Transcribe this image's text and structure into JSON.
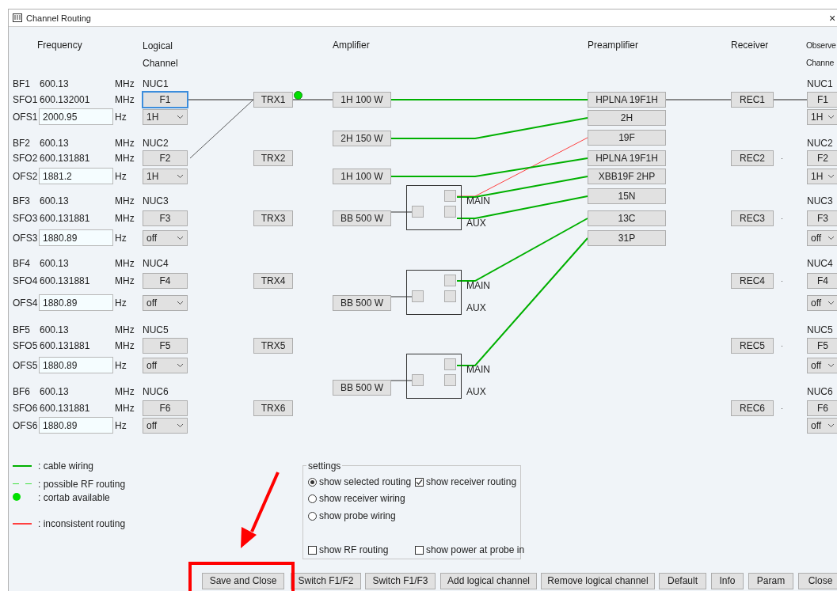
{
  "window": {
    "title": "Channel Routing",
    "close": "×"
  },
  "headers": [
    {
      "kind": "frequency",
      "lines": [
        "Frequency"
      ]
    },
    {
      "kind": "logical",
      "lines": [
        "Logical",
        "Channel"
      ]
    },
    {
      "kind": "amplifier",
      "lines": [
        "Amplifier"
      ]
    },
    {
      "kind": "preamplifier",
      "lines": [
        "Preamplifier"
      ]
    },
    {
      "kind": "receiver",
      "lines": [
        "Receiver"
      ]
    },
    {
      "kind": "observe",
      "lines": [
        "Observe",
        "Channe"
      ]
    }
  ],
  "channels": [
    {
      "bf_label": "BF1",
      "bf_value": "600.13",
      "bf_unit": "MHz",
      "sfo_label": "SFO1",
      "sfo_value": "600.132001",
      "sfo_unit": "MHz",
      "ofs_label": "OFS1",
      "ofs_value": "2000.95",
      "ofs_unit": "Hz",
      "nucleus": "NUC1",
      "button": "F1",
      "focused": true,
      "mode": "1H",
      "transmitter": "TRX1",
      "cortab": true
    },
    {
      "bf_label": "BF2",
      "bf_value": "600.13",
      "bf_unit": "MHz",
      "sfo_label": "SFO2",
      "sfo_value": "600.131881",
      "sfo_unit": "MHz",
      "ofs_label": "OFS2",
      "ofs_value": "1881.2",
      "ofs_unit": "Hz",
      "nucleus": "NUC2",
      "button": "F2",
      "focused": false,
      "mode": "1H",
      "transmitter": "TRX2",
      "cortab": false
    },
    {
      "bf_label": "BF3",
      "bf_value": "600.13",
      "bf_unit": "MHz",
      "sfo_label": "SFO3",
      "sfo_value": "600.131881",
      "sfo_unit": "MHz",
      "ofs_label": "OFS3",
      "ofs_value": "1880.89",
      "ofs_unit": "Hz",
      "nucleus": "NUC3",
      "button": "F3",
      "focused": false,
      "mode": "off",
      "transmitter": "TRX3",
      "cortab": false
    },
    {
      "bf_label": "BF4",
      "bf_value": "600.13",
      "bf_unit": "MHz",
      "sfo_label": "SFO4",
      "sfo_value": "600.131881",
      "sfo_unit": "MHz",
      "ofs_label": "OFS4",
      "ofs_value": "1880.89",
      "ofs_unit": "Hz",
      "nucleus": "NUC4",
      "button": "F4",
      "focused": false,
      "mode": "off",
      "transmitter": "TRX4",
      "cortab": false
    },
    {
      "bf_label": "BF5",
      "bf_value": "600.13",
      "bf_unit": "MHz",
      "sfo_label": "SFO5",
      "sfo_value": "600.131881",
      "sfo_unit": "MHz",
      "ofs_label": "OFS5",
      "ofs_value": "1880.89",
      "ofs_unit": "Hz",
      "nucleus": "NUC5",
      "button": "F5",
      "focused": false,
      "mode": "off",
      "transmitter": "TRX5",
      "cortab": false
    },
    {
      "bf_label": "BF6",
      "bf_value": "600.13",
      "bf_unit": "MHz",
      "sfo_label": "SFO6",
      "sfo_value": "600.131881",
      "sfo_unit": "MHz",
      "ofs_label": "OFS6",
      "ofs_value": "1880.89",
      "ofs_unit": "Hz",
      "nucleus": "NUC6",
      "button": "F6",
      "focused": false,
      "mode": "off",
      "transmitter": "TRX6",
      "cortab": false
    }
  ],
  "amplifiers": [
    {
      "kind": "direct",
      "label": "1H 100 W"
    },
    {
      "kind": "direct",
      "label": "2H 150 W"
    },
    {
      "kind": "direct",
      "label": "1H 100 W"
    },
    {
      "kind": "switched",
      "label": "BB 500 W",
      "outputs": [
        "MAIN",
        "AUX"
      ]
    },
    {
      "kind": "switched",
      "label": "BB 500 W",
      "outputs": [
        "MAIN",
        "AUX"
      ]
    },
    {
      "kind": "switched",
      "label": "BB 500 W",
      "outputs": [
        "MAIN",
        "AUX"
      ]
    }
  ],
  "preamplifiers": [
    {
      "label": "HPLNA 19F1H",
      "inconsistent": false
    },
    {
      "label": "2H",
      "inconsistent": false
    },
    {
      "label": "19F",
      "inconsistent": true
    },
    {
      "label": "HPLNA 19F1H",
      "inconsistent": false
    },
    {
      "label": "XBB19F 2HP",
      "inconsistent": false
    },
    {
      "label": "15N",
      "inconsistent": false
    },
    {
      "label": "13C",
      "inconsistent": false
    },
    {
      "label": "31P",
      "inconsistent": false
    }
  ],
  "receivers": [
    "REC1",
    "REC2",
    "REC3",
    "REC4",
    "REC5",
    "REC6"
  ],
  "observe_channels": [
    {
      "nucleus": "NUC1",
      "button": "F1",
      "mode": "1H"
    },
    {
      "nucleus": "NUC2",
      "button": "F2",
      "mode": "1H"
    },
    {
      "nucleus": "NUC3",
      "button": "F3",
      "mode": "off"
    },
    {
      "nucleus": "NUC4",
      "button": "F4",
      "mode": "off"
    },
    {
      "nucleus": "NUC5",
      "button": "F5",
      "mode": "off"
    },
    {
      "nucleus": "NUC6",
      "button": "F6",
      "mode": "off"
    }
  ],
  "legend": [
    {
      "kind": "line",
      "color": "#00b000",
      "text": ": cable wiring"
    },
    {
      "kind": "dashed",
      "color": "#40e040",
      "text": ": possible RF routing"
    },
    {
      "kind": "dot",
      "color": "#00e000",
      "text": ": cortab available"
    },
    {
      "kind": "line",
      "color": "#ff4040",
      "text": ": inconsistent routing"
    }
  ],
  "settings": {
    "title": "settings",
    "options": [
      {
        "kind": "radio",
        "label": "show selected routing",
        "selected": true
      },
      {
        "kind": "checkbox",
        "label": "show receiver routing",
        "checked": true
      },
      {
        "kind": "radio",
        "label": "show receiver wiring",
        "selected": false
      },
      {
        "kind": "radio",
        "label": "show probe wiring",
        "selected": false
      },
      {
        "kind": "checkbox",
        "label": "show RF routing",
        "checked": false
      },
      {
        "kind": "checkbox",
        "label": "show power at probe in",
        "checked": false
      }
    ]
  },
  "buttons": [
    "Save and Close",
    "Switch F1/F2",
    "Switch F1/F3",
    "Add logical channel",
    "Remove logical channel",
    "Default",
    "Info",
    "Param",
    "Close"
  ]
}
